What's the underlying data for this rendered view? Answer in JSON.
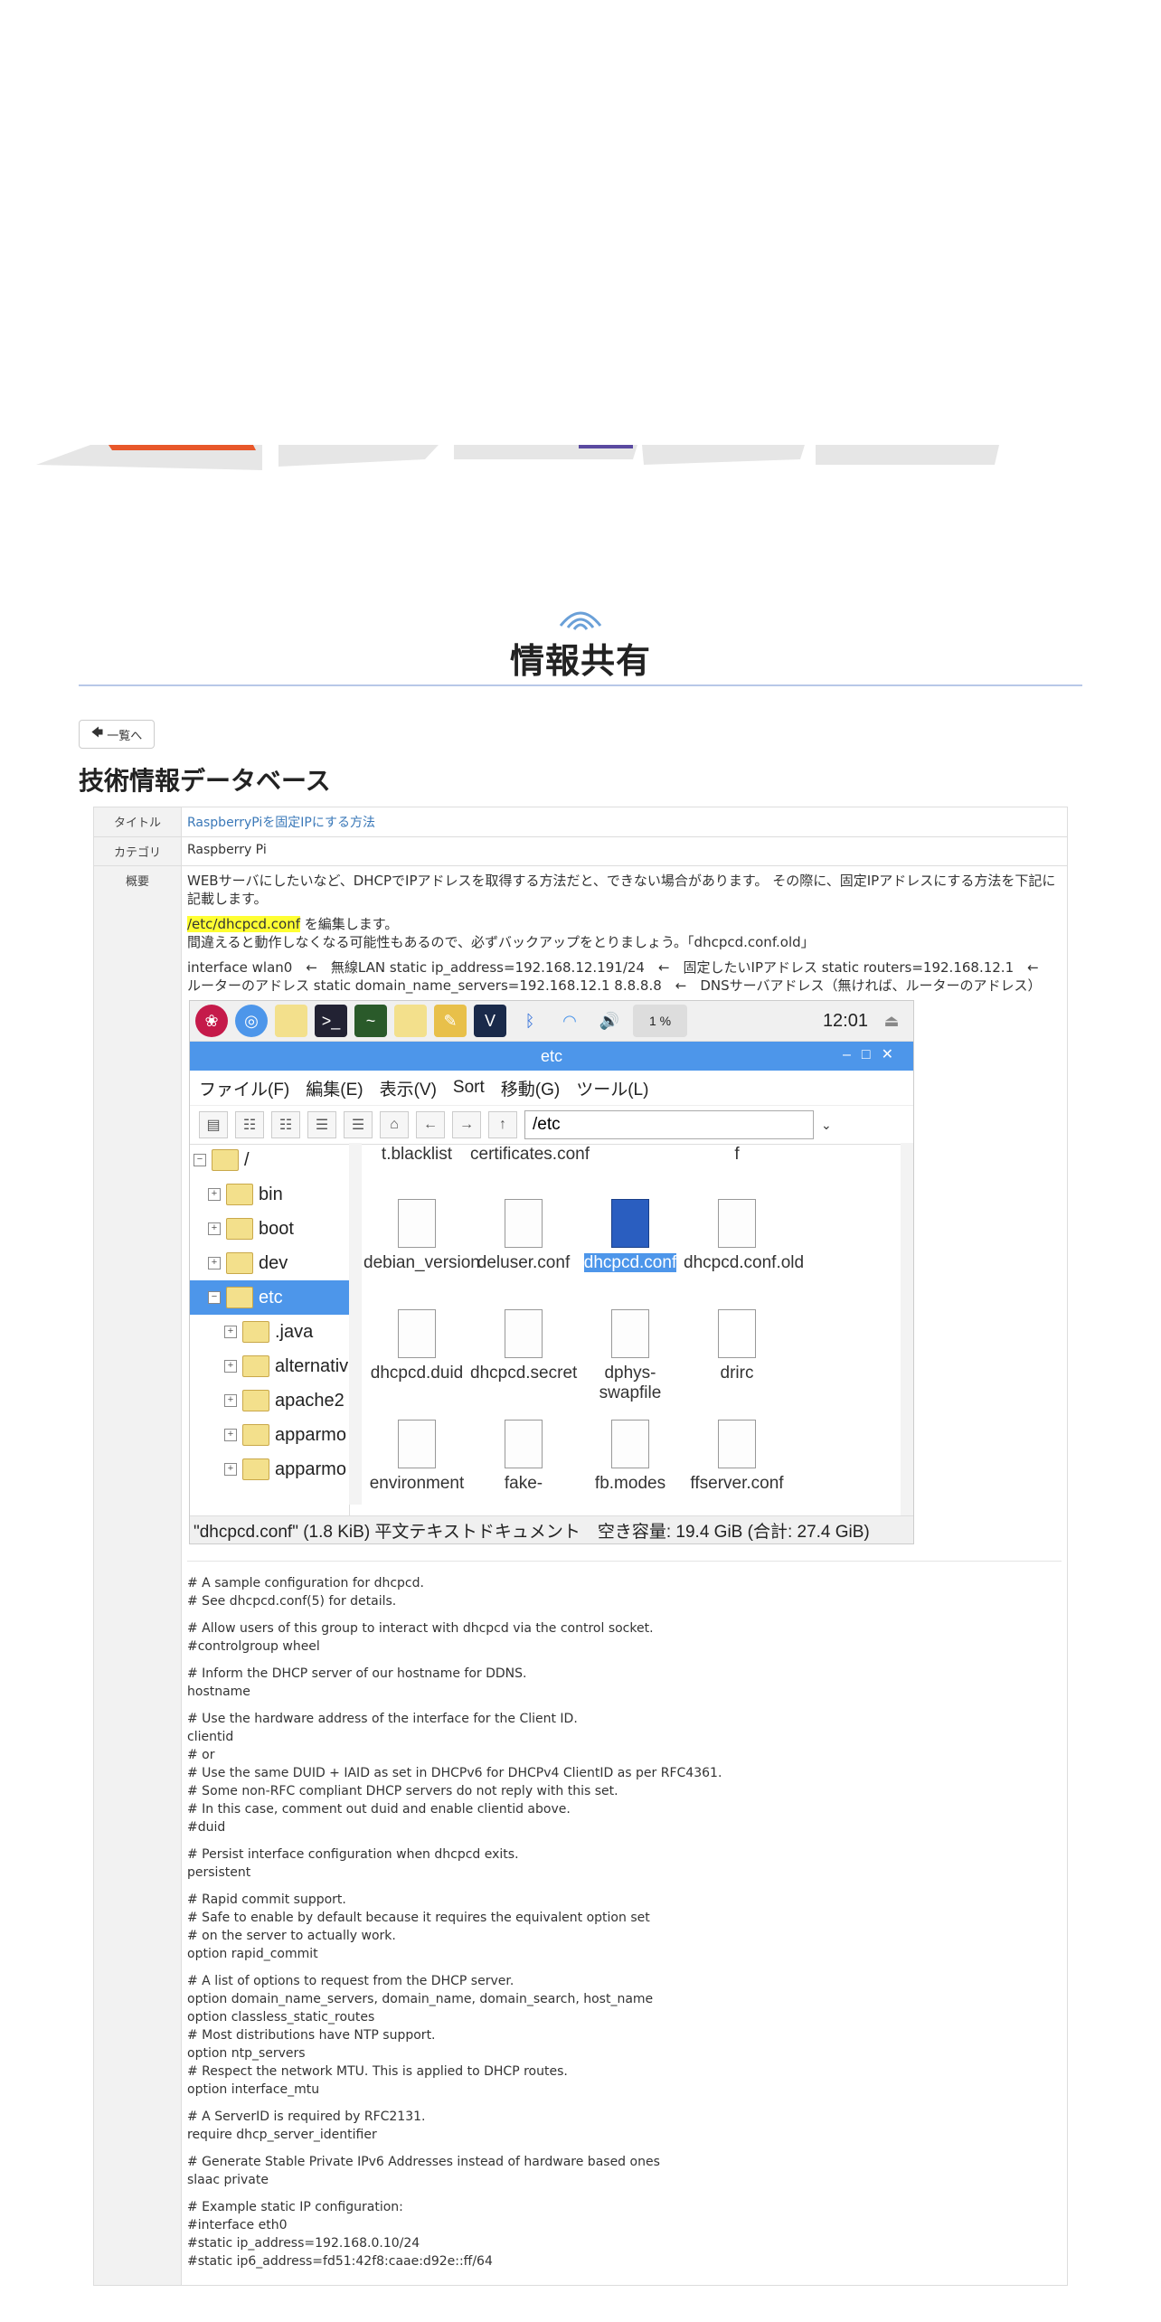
{
  "header": {
    "title": "情報共有"
  },
  "nav": {
    "back_label": "一覧へ"
  },
  "section": {
    "title": "技術情報データベース"
  },
  "detail": {
    "title_label": "タイトル",
    "title_value": "RaspberryPiを固定IPにする方法",
    "category_label": "カテゴリ",
    "category_value": "Raspberry Pi",
    "summary_label": "概要",
    "intro_lines": [
      "WEBサーバにしたいなど、DHCPでIPアドレスを取得する方法だと、できない場合があります。",
      "その際に、固定IPアドレスにする方法を下記に記載します。"
    ],
    "edit_file": "/etc/dhcpcd.conf",
    "edit_suffix": "を編集します。",
    "warning": "間違えると動作しなくなる可能性もあるので、必ずバックアップをとりましょう。「dhcpcd.conf.old」",
    "config_lines": [
      "interface wlan0　←　無線LAN",
      "static ip_address=192.168.12.191/24　←　固定したいIPアドレス",
      "static routers=192.168.12.1　←　ルーターのアドレス",
      "static domain_name_servers=192.168.12.1 8.8.8.8　←　DNSサーバアドレス（無ければ、ルーターのアドレス）"
    ]
  },
  "file_manager": {
    "panel_clock": "12:01",
    "panel_cpu": "1 %",
    "window_title": "etc",
    "menu": [
      "ファイル(F)",
      "編集(E)",
      "表示(V)",
      "Sort",
      "移動(G)",
      "ツール(L)"
    ],
    "path": "/etc",
    "tree": [
      {
        "label": "/",
        "selected": false
      },
      {
        "label": "bin",
        "selected": false
      },
      {
        "label": "boot",
        "selected": false
      },
      {
        "label": "dev",
        "selected": false
      },
      {
        "label": "etc",
        "selected": true
      },
      {
        "label": ".java",
        "selected": false
      },
      {
        "label": "alternativ",
        "selected": false
      },
      {
        "label": "apache2",
        "selected": false
      },
      {
        "label": "apparmo",
        "selected": false
      },
      {
        "label": "apparmo",
        "selected": false
      }
    ],
    "files_row0": [
      "t.blacklist",
      "certificates.conf",
      "",
      "f"
    ],
    "files": [
      {
        "name": "debian_version",
        "kind": "doc"
      },
      {
        "name": "deluser.conf",
        "kind": "doc"
      },
      {
        "name": "dhcpcd.conf",
        "kind": "selected"
      },
      {
        "name": "dhcpcd.conf.old",
        "kind": "blank"
      },
      {
        "name": "dhcpcd.duid",
        "kind": "doc"
      },
      {
        "name": "dhcpcd.secret",
        "kind": "blank"
      },
      {
        "name": "dphys-swapfile",
        "kind": "doc"
      },
      {
        "name": "drirc",
        "kind": "globe"
      },
      {
        "name": "environment",
        "kind": "doc"
      },
      {
        "name": "fake-",
        "kind": "doc"
      },
      {
        "name": "fb.modes",
        "kind": "doc"
      },
      {
        "name": "ffserver.conf",
        "kind": "doc"
      }
    ],
    "status": "\"dhcpcd.conf\" (1.8 KiB) 平文テキストドキュメント　空き容量: 19.4 GiB (合計: 27.4 GiB)"
  },
  "conf_blocks": [
    [
      "# A sample configuration for dhcpcd.",
      "# See dhcpcd.conf(5) for details."
    ],
    [
      "# Allow users of this group to interact with dhcpcd via the control socket.",
      "#controlgroup wheel"
    ],
    [
      "# Inform the DHCP server of our hostname for DDNS.",
      "hostname"
    ],
    [
      "# Use the hardware address of the interface for the Client ID.",
      "clientid",
      "# or",
      "# Use the same DUID + IAID as set in DHCPv6 for DHCPv4 ClientID as per RFC4361.",
      "# Some non-RFC compliant DHCP servers do not reply with this set.",
      "# In this case, comment out duid and enable clientid above.",
      "#duid"
    ],
    [
      "# Persist interface configuration when dhcpcd exits.",
      "persistent"
    ],
    [
      "# Rapid commit support.",
      "# Safe to enable by default because it requires the equivalent option set",
      "# on the server to actually work.",
      "option rapid_commit"
    ],
    [
      "# A list of options to request from the DHCP server.",
      "option domain_name_servers, domain_name, domain_search, host_name",
      "option classless_static_routes",
      "# Most distributions have NTP support.",
      "option ntp_servers",
      "# Respect the network MTU. This is applied to DHCP routes.",
      "option interface_mtu"
    ],
    [
      "# A ServerID is required by RFC2131.",
      "require dhcp_server_identifier"
    ],
    [
      "# Generate Stable Private IPv6 Addresses instead of hardware based ones",
      "slaac private"
    ],
    [
      "# Example static IP configuration:",
      "#interface eth0",
      "#static ip_address=192.168.0.10/24",
      "#static ip6_address=fd51:42f8:caae:d92e::ff/64"
    ]
  ]
}
